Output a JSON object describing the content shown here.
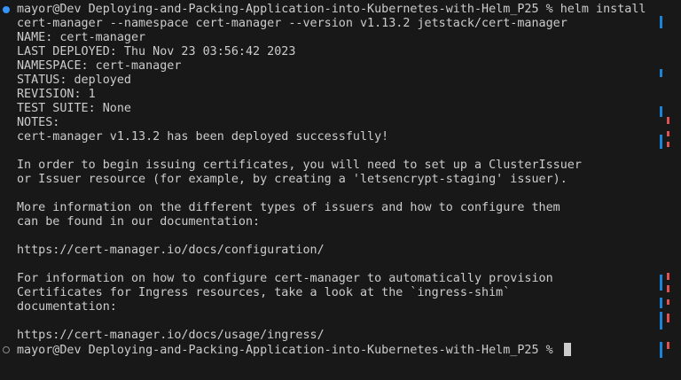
{
  "terminal": {
    "lines": [
      {
        "text": "mayor@Dev Deploying-and-Packing-Application-into-Kubernetes-with-Helm_P25 % helm install",
        "marker": "filled"
      },
      {
        "text": "cert-manager --namespace cert-manager --version v1.13.2 jetstack/cert-manager"
      },
      {
        "text": "NAME: cert-manager"
      },
      {
        "text": "LAST DEPLOYED: Thu Nov 23 03:56:42 2023"
      },
      {
        "text": "NAMESPACE: cert-manager"
      },
      {
        "text": "STATUS: deployed"
      },
      {
        "text": "REVISION: 1"
      },
      {
        "text": "TEST SUITE: None"
      },
      {
        "text": "NOTES:"
      },
      {
        "text": "cert-manager v1.13.2 has been deployed successfully!"
      },
      {
        "text": ""
      },
      {
        "text": "In order to begin issuing certificates, you will need to set up a ClusterIssuer"
      },
      {
        "text": "or Issuer resource (for example, by creating a 'letsencrypt-staging' issuer)."
      },
      {
        "text": ""
      },
      {
        "text": "More information on the different types of issuers and how to configure them"
      },
      {
        "text": "can be found in our documentation:"
      },
      {
        "text": ""
      },
      {
        "text": "https://cert-manager.io/docs/configuration/"
      },
      {
        "text": ""
      },
      {
        "text": "For information on how to configure cert-manager to automatically provision"
      },
      {
        "text": "Certificates for Ingress resources, take a look at the `ingress-shim`"
      },
      {
        "text": "documentation:"
      },
      {
        "text": ""
      },
      {
        "text": "https://cert-manager.io/docs/usage/ingress/"
      },
      {
        "text": "mayor@Dev Deploying-and-Packing-Application-into-Kubernetes-with-Helm_P25 % ",
        "marker": "hollow",
        "cursor": true
      }
    ]
  },
  "colors": {
    "background": "#181818",
    "text": "#cccccc",
    "success_marker": "#3794ff",
    "ruler_blue": "#1a85d8",
    "ruler_red": "#e05252"
  }
}
